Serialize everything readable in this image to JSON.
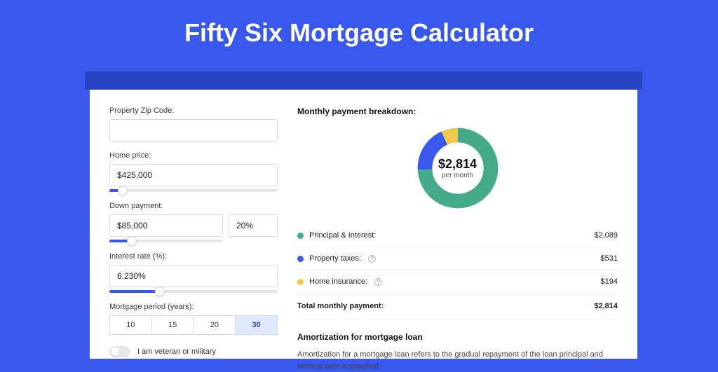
{
  "title": "Fifty Six Mortgage Calculator",
  "colors": {
    "principal": "#44ab8a",
    "taxes": "#3757ed",
    "insurance": "#f2c94c"
  },
  "left": {
    "zip_label": "Property Zip Code:",
    "zip_value": "",
    "home_price_label": "Home price:",
    "home_price_value": "$425,000",
    "home_price_slider_pct": 8,
    "down_label": "Down payment:",
    "down_value": "$85,000",
    "down_pct_value": "20%",
    "down_slider_pct": 20,
    "rate_label": "Interest rate (%):",
    "rate_value": "6.230%",
    "rate_slider_pct": 30,
    "period_label": "Mortgage period (years):",
    "periods": [
      "10",
      "15",
      "20",
      "30"
    ],
    "period_active": "30",
    "veteran_label": "I am veteran or military"
  },
  "right": {
    "breakdown_title": "Monthly payment breakdown:",
    "donut_amount": "$2,814",
    "donut_sub": "per month",
    "items": [
      {
        "label": "Principal & Interest:",
        "value": "$2,089",
        "colorKey": "principal",
        "info": false
      },
      {
        "label": "Property taxes:",
        "value": "$531",
        "colorKey": "taxes",
        "info": true
      },
      {
        "label": "Home insurance:",
        "value": "$194",
        "colorKey": "insurance",
        "info": true
      }
    ],
    "total_label": "Total monthly payment:",
    "total_value": "$2,814",
    "amort_title": "Amortization for mortgage loan",
    "amort_body": "Amortization for a mortgage loan refers to the gradual repayment of the loan principal and interest over a specified"
  },
  "chart_data": {
    "type": "pie",
    "title": "Monthly payment breakdown",
    "series": [
      {
        "name": "Principal & Interest",
        "value": 2089
      },
      {
        "name": "Property taxes",
        "value": 531
      },
      {
        "name": "Home insurance",
        "value": 194
      }
    ],
    "total": 2814
  }
}
